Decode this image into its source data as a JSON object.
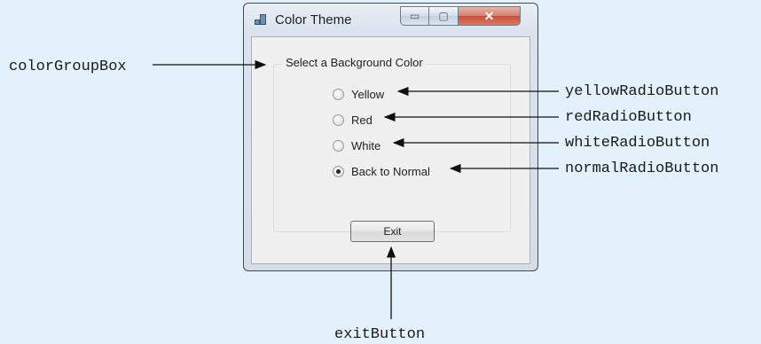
{
  "window": {
    "title": "Color Theme",
    "buttons": {
      "minimize_icon": "minimize-icon",
      "maximize_icon": "maximize-icon",
      "close_icon": "close-icon"
    }
  },
  "group": {
    "caption": "Select a Background Color",
    "radios": [
      {
        "label": "Yellow",
        "checked": false
      },
      {
        "label": "Red",
        "checked": false
      },
      {
        "label": "White",
        "checked": false
      },
      {
        "label": "Back to Normal",
        "checked": true
      }
    ]
  },
  "exit_button": {
    "label": "Exit"
  },
  "callouts": {
    "group_box": "colorGroupBox",
    "yellow": "yellowRadioButton",
    "red": "redRadioButton",
    "white": "whiteRadioButton",
    "normal": "normalRadioButton",
    "exit": "exitButton"
  }
}
